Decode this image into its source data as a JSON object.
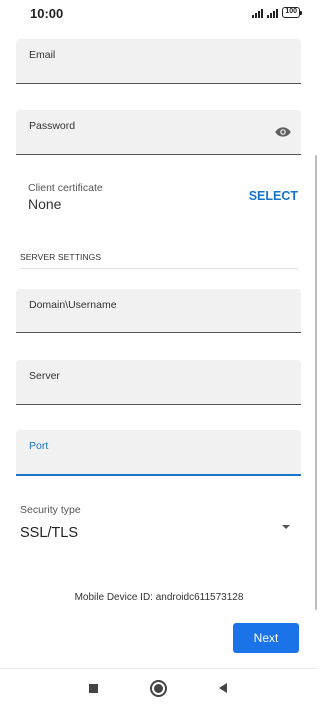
{
  "status_bar": {
    "time": "10:00",
    "battery": "100",
    "icons": [
      "signal-icon",
      "signal-icon",
      "battery-icon"
    ]
  },
  "form": {
    "email": {
      "label": "Email",
      "value": ""
    },
    "password": {
      "label": "Password",
      "value": "",
      "icon": "eye-icon"
    },
    "client_certificate": {
      "label": "Client certificate",
      "value": "None",
      "action": "SELECT"
    }
  },
  "server_settings": {
    "heading": "SERVER SETTINGS",
    "domain_username": {
      "label": "Domain\\Username",
      "value": ""
    },
    "server": {
      "label": "Server",
      "value": ""
    },
    "port": {
      "label": "Port",
      "value": "",
      "focused": true
    },
    "security_type": {
      "label": "Security type",
      "value": "SSL/TLS",
      "icon": "dropdown-arrow-icon"
    }
  },
  "device_id": "Mobile Device ID: androidc611573128",
  "actions": {
    "next_label": "Next"
  },
  "colors": {
    "accent": "#1a73e8",
    "field_bg": "#f1f1f1",
    "link": "#1a73c8"
  },
  "nav_bar": {
    "icons": [
      "recents-icon",
      "home-icon",
      "back-icon"
    ]
  }
}
